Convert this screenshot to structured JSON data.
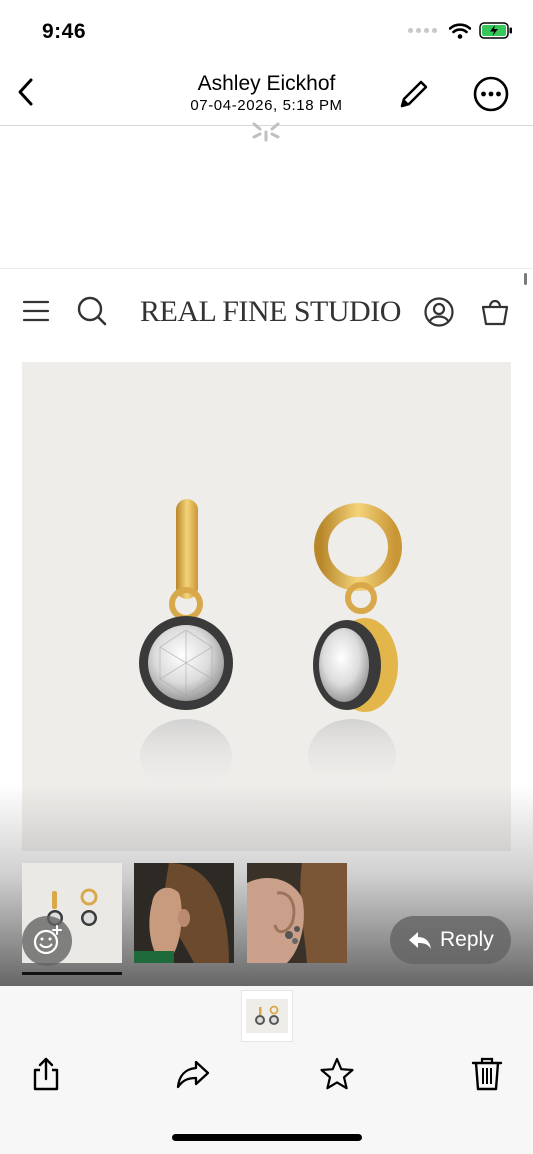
{
  "status_bar": {
    "time": "9:46",
    "battery": "charging"
  },
  "nav": {
    "sender": "Ashley Eickhof",
    "date": "07-04-2026, 5:18 PM"
  },
  "store": {
    "logo_text": "REAL FINE STUDIO"
  },
  "actions": {
    "reply_label": "Reply"
  },
  "icons": {
    "back": "chevron-left-icon",
    "edit": "pencil-icon",
    "more": "ellipsis-circle-icon",
    "menu": "hamburger-icon",
    "search": "search-icon",
    "account": "user-circle-icon",
    "bag": "shopping-bag-icon",
    "emoji": "emoji-add-icon",
    "reply": "reply-arrow-icon",
    "share": "share-icon",
    "forward": "forward-arrow-icon",
    "favorite": "star-icon",
    "delete": "trash-icon"
  },
  "colors": {
    "product_bg": "#efedea",
    "gold": "#e2b64a",
    "dark_metal": "#3a3a3a"
  }
}
